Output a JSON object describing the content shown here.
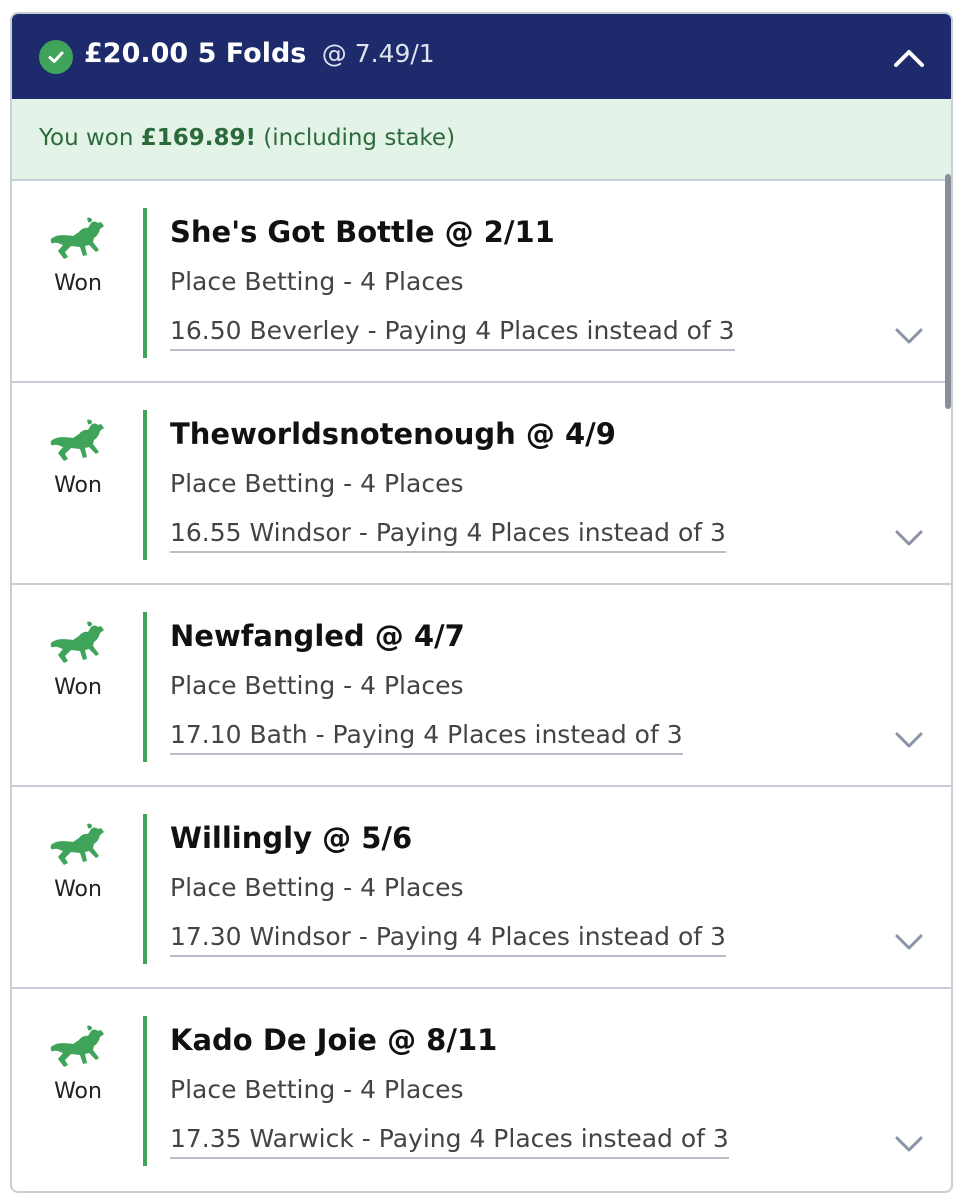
{
  "bet": {
    "stake": "£20.00",
    "type": "5 Folds",
    "odds": "@ 7.49/1",
    "status_icon": "check-circle-icon",
    "accent_color": "#1d2a6b",
    "won_color": "#3fa35a"
  },
  "banner": {
    "prefix": "You won ",
    "amount": "£169.89!",
    "suffix": " (including stake)"
  },
  "selections": [
    {
      "status": "Won",
      "name": "She's Got Bottle @ 2/11",
      "market": "Place Betting - 4 Places",
      "event": "16.50 Beverley - Paying 4 Places instead of 3"
    },
    {
      "status": "Won",
      "name": "Theworldsnotenough @ 4/9",
      "market": "Place Betting - 4 Places",
      "event": "16.55 Windsor - Paying 4 Places instead of 3"
    },
    {
      "status": "Won",
      "name": "Newfangled @ 4/7",
      "market": "Place Betting - 4 Places",
      "event": "17.10 Bath - Paying 4 Places instead of 3"
    },
    {
      "status": "Won",
      "name": "Willingly @ 5/6",
      "market": "Place Betting - 4 Places",
      "event": "17.30 Windsor - Paying 4 Places instead of 3"
    },
    {
      "status": "Won",
      "name": "Kado De Joie @ 8/11",
      "market": "Place Betting - 4 Places",
      "event": "17.35 Warwick - Paying 4 Places instead of 3"
    }
  ]
}
